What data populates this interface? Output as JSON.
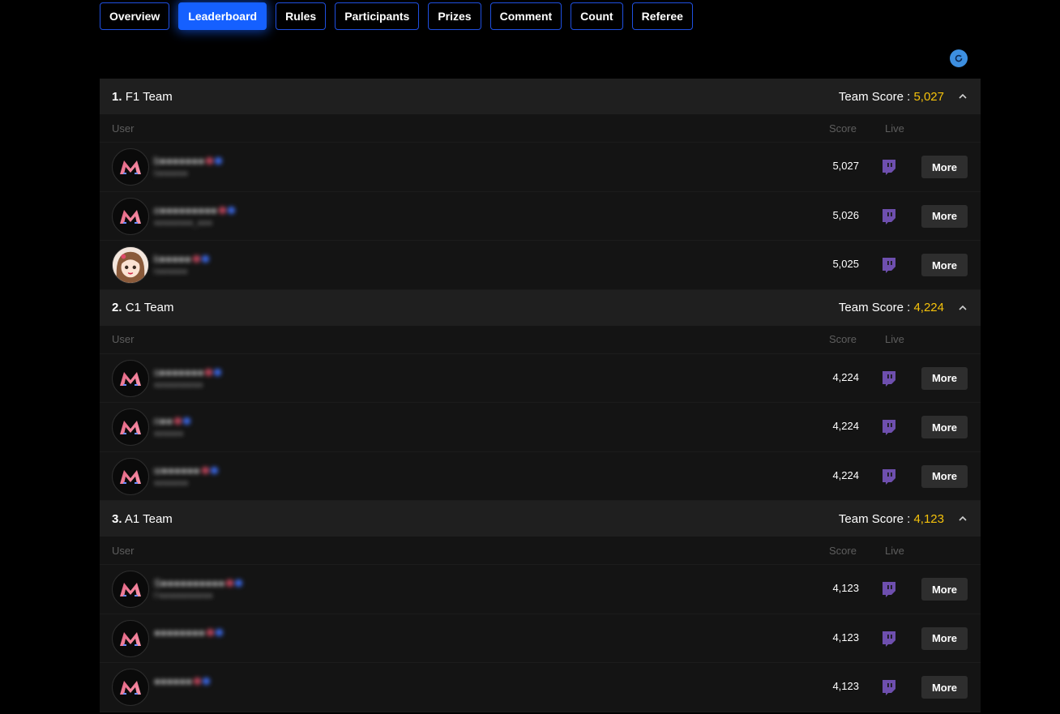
{
  "tabs": [
    "Overview",
    "Leaderboard",
    "Rules",
    "Participants",
    "Prizes",
    "Comment",
    "Count",
    "Referee"
  ],
  "active_tab": "Leaderboard",
  "colors": {
    "accent": "#1560ff",
    "team_score": "#f5c20b",
    "twitch": "#6e4fae"
  },
  "columns": {
    "user": "User",
    "score": "Score",
    "live": "Live"
  },
  "more_label": "More",
  "team_score_label": "Team Score :",
  "teams": [
    {
      "rank": "1.",
      "name": "F1 Team",
      "score": "5,027",
      "members": [
        {
          "name": "b●●●●●●●",
          "sub": "b●●●●●●",
          "score": "5,027",
          "avatar": "logo"
        },
        {
          "name": "e●●●●●●●●●",
          "sub": "●●●●●●●●_●●●",
          "score": "5,026",
          "avatar": "logo"
        },
        {
          "name": "k●●●●●",
          "sub": "k●●●●●●",
          "score": "5,025",
          "avatar": "anime"
        }
      ]
    },
    {
      "rank": "2.",
      "name": "C1 Team",
      "score": "4,224",
      "members": [
        {
          "name": "s●●●●●●●",
          "sub": "●●●●●●●●●●",
          "score": "4,224",
          "avatar": "logo"
        },
        {
          "name": "n●●",
          "sub": "●●●●●●",
          "score": "4,224",
          "avatar": "logo"
        },
        {
          "name": "w●●●●●●",
          "sub": "●●●●●●●",
          "score": "4,224",
          "avatar": "logo"
        }
      ]
    },
    {
      "rank": "3.",
      "name": "A1 Team",
      "score": "4,123",
      "members": [
        {
          "name": "S●●●●●●●●●●",
          "sub": "F●●●●●●●●●●●",
          "score": "4,123",
          "avatar": "logo"
        },
        {
          "name": "●●●●●●●●",
          "sub": "",
          "score": "4,123",
          "avatar": "logo"
        },
        {
          "name": "●●●●●●",
          "sub": "",
          "score": "4,123",
          "avatar": "logo"
        }
      ]
    }
  ]
}
